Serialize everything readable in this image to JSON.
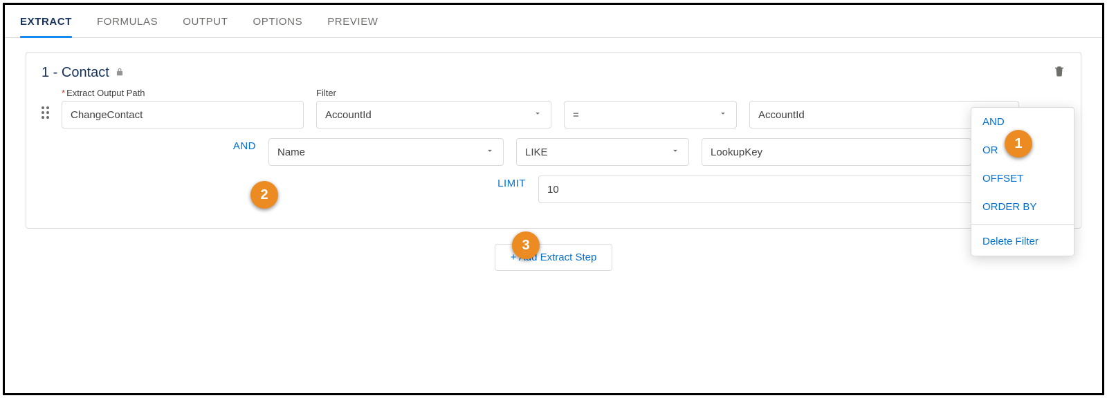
{
  "tabs": {
    "items": [
      "EXTRACT",
      "FORMULAS",
      "OUTPUT",
      "OPTIONS",
      "PREVIEW"
    ],
    "active_index": 0
  },
  "panel": {
    "title": "1 - Contact",
    "extract_output_path": {
      "label": "Extract Output Path",
      "required_marker": "*",
      "value": "ChangeContact"
    },
    "filter_label": "Filter",
    "rows": [
      {
        "connector": null,
        "field": "AccountId",
        "operator": "=",
        "value": "AccountId"
      },
      {
        "connector": "AND",
        "field": "Name",
        "operator": "LIKE",
        "value": "LookupKey"
      }
    ],
    "limit": {
      "label": "LIMIT",
      "value": "10"
    }
  },
  "dropdown": {
    "items": [
      "AND",
      "OR",
      "OFFSET",
      "ORDER BY"
    ],
    "delete_label": "Delete Filter"
  },
  "add_step_label": "+ Add Extract Step",
  "callouts": [
    "1",
    "2",
    "3"
  ]
}
